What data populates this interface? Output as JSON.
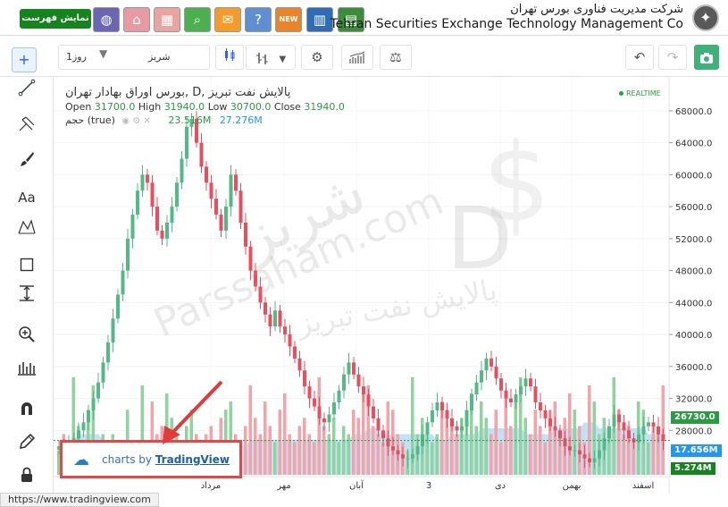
{
  "banner": {
    "list_button": "نمایش فهرست",
    "company_fa": "شرکت مدیریت فناوری بورس تهران",
    "company_en": "Tehran Securities Exchange Technology Management Co",
    "nav_icons": [
      {
        "name": "globe-icon",
        "glyph": "◍",
        "color": "#6a66b5"
      },
      {
        "name": "home-icon",
        "glyph": "⌂",
        "color": "#e89aa2"
      },
      {
        "name": "table-icon",
        "glyph": "▦",
        "color": "#e9a4a2"
      },
      {
        "name": "search-icon",
        "glyph": "⌕",
        "color": "#4caf50"
      },
      {
        "name": "message-icon",
        "glyph": "✉",
        "color": "#f39c2b"
      },
      {
        "name": "help-icon",
        "glyph": "?",
        "color": "#5f8fd0"
      },
      {
        "name": "new-icon",
        "glyph": "NEW",
        "color": "#e8852a"
      },
      {
        "name": "chart-book-icon",
        "glyph": "▥",
        "color": "#2f6cb5"
      },
      {
        "name": "market-map-icon",
        "glyph": "▤",
        "color": "#3c8c3c"
      }
    ]
  },
  "toolbar": {
    "interval": "1روز",
    "symbol": "شریز"
  },
  "legend": {
    "title": "بورس اوراق بهادار تهران, D, پالایش نفت تبریز",
    "open_label": "Open",
    "open": "31700.0",
    "high_label": "High",
    "high": "31940.0",
    "low_label": "Low",
    "low": "30700.0",
    "close_label": "Close",
    "close": "31940.0",
    "volume_label": "حجم (true)",
    "volume": "23.516M",
    "volume_ma": "27.276M",
    "realtime": "REALTIME"
  },
  "price_axis": {
    "labels": [
      "68000.0",
      "64000.0",
      "60000.0",
      "56000.0",
      "52000.0",
      "48000.0",
      "44000.0",
      "40000.0",
      "36000.0",
      "32000.0",
      "28000.0"
    ],
    "last_price": "26730.0",
    "volume_ma_tag": "17.656M",
    "volume_tag": "5.274M"
  },
  "time_axis": [
    "مرداد",
    "مهر",
    "آبان",
    "3",
    "دی",
    "بهمن",
    "اسفند"
  ],
  "credit": {
    "prefix": "charts by",
    "brand": "TradingView"
  },
  "watermark": {
    "site": "Parssaham.com",
    "fa": "شریز",
    "fa_name": "پالایش نفت تبریز",
    "interval": "D"
  },
  "status_url": "https://www.tradingview.com",
  "colors": {
    "up": "#53b987",
    "down": "#eb4d5c",
    "up_volume": "#8fd39e",
    "down_volume": "#f7a1a8",
    "volume_ma": "#8ec9f0"
  },
  "chart_data": {
    "type": "candlestick",
    "title": "بورس اوراق بهادار تهران, D, پالایش نفت تبریز",
    "ylim": [
      23000,
      70000
    ],
    "y_ticks": [
      28000,
      32000,
      36000,
      40000,
      44000,
      48000,
      52000,
      56000,
      60000,
      64000,
      68000
    ],
    "x_ticks": [
      "مرداد",
      "مهر",
      "آبان",
      "3",
      "دی",
      "بهمن",
      "اسفند"
    ],
    "last_price": 26730,
    "closes": [
      26000,
      25500,
      26200,
      27000,
      28000,
      29000,
      30500,
      32000,
      34000,
      36500,
      39000,
      42000,
      45000,
      48000,
      52000,
      55000,
      58000,
      60000,
      59000,
      56000,
      53000,
      52000,
      54000,
      56000,
      59000,
      62000,
      66000,
      67000,
      64000,
      61000,
      59000,
      57000,
      55000,
      53000,
      56000,
      60000,
      58000,
      54000,
      51000,
      48000,
      46000,
      44000,
      42500,
      41000,
      43000,
      41000,
      40000,
      38500,
      37000,
      35500,
      33500,
      32000,
      31000,
      29500,
      29000,
      30000,
      31500,
      33000,
      35000,
      36500,
      35000,
      33500,
      32500,
      31000,
      29500,
      28000,
      27000,
      26000,
      25500,
      25000,
      24500,
      24500,
      25000,
      26000,
      27500,
      29000,
      30500,
      31500,
      30500,
      29500,
      28500,
      28000,
      28500,
      30500,
      32500,
      34000,
      35500,
      37000,
      36000,
      34500,
      33000,
      32000,
      31500,
      32500,
      33500,
      34500,
      33500,
      31500,
      30500,
      29500,
      28500,
      28000,
      27000,
      26000,
      25500,
      25500,
      25000,
      24500,
      24000,
      24500,
      25500,
      27000,
      28500,
      30000,
      29000,
      28000,
      27000,
      26500,
      27500,
      28500,
      29000,
      28500,
      27500,
      26730
    ],
    "volumes": [
      3,
      5,
      4,
      12,
      6,
      3,
      8,
      11,
      4,
      5,
      3,
      5,
      4,
      3,
      8,
      4,
      3,
      11,
      4,
      9,
      5,
      6,
      10,
      7,
      5,
      4,
      6,
      8,
      5,
      4,
      5,
      6,
      4,
      7,
      8,
      9,
      5,
      4,
      6,
      11,
      7,
      5,
      9,
      6,
      4,
      8,
      10,
      5,
      4,
      6,
      7,
      5,
      4,
      12,
      6,
      5,
      7,
      4,
      6,
      5,
      8,
      7,
      10,
      11,
      6,
      5,
      4,
      9,
      8,
      5,
      4,
      3,
      12,
      5,
      7,
      6,
      4,
      5,
      9,
      8,
      6,
      5,
      7,
      8,
      10,
      6,
      9,
      7,
      5,
      8,
      4,
      10,
      6,
      9,
      12,
      7,
      5,
      8,
      6,
      4,
      8,
      9,
      5,
      7,
      10,
      8,
      6,
      4,
      11,
      9,
      5,
      7,
      6,
      12,
      8,
      5,
      6,
      4,
      9,
      8,
      4,
      6,
      5,
      11
    ],
    "volume_ma": [
      6,
      6,
      6,
      6,
      7,
      7,
      7,
      7,
      7,
      6,
      6,
      6,
      6,
      6,
      6,
      6,
      6,
      6,
      6,
      6,
      6,
      6,
      7,
      7,
      6,
      6,
      6,
      6,
      6,
      6,
      5,
      5,
      5,
      5,
      5,
      5,
      5,
      5,
      5,
      6,
      6,
      6,
      6,
      6,
      6,
      6,
      6,
      6,
      6,
      6,
      6,
      6,
      6,
      6,
      6,
      6,
      6,
      6,
      6,
      6,
      7,
      7,
      7,
      8,
      8,
      8,
      7,
      7,
      7,
      7,
      7,
      7,
      7,
      7,
      7,
      7,
      7,
      6,
      6,
      6,
      7,
      7,
      7,
      7,
      7,
      7,
      8,
      8,
      8,
      8,
      8,
      8,
      8,
      8,
      8,
      7,
      7,
      7,
      7,
      7,
      7,
      8,
      8,
      8,
      8,
      8,
      8,
      9,
      9,
      9,
      8,
      8,
      8,
      8,
      8,
      8,
      8,
      8,
      8,
      8,
      7,
      7,
      7,
      7
    ]
  }
}
